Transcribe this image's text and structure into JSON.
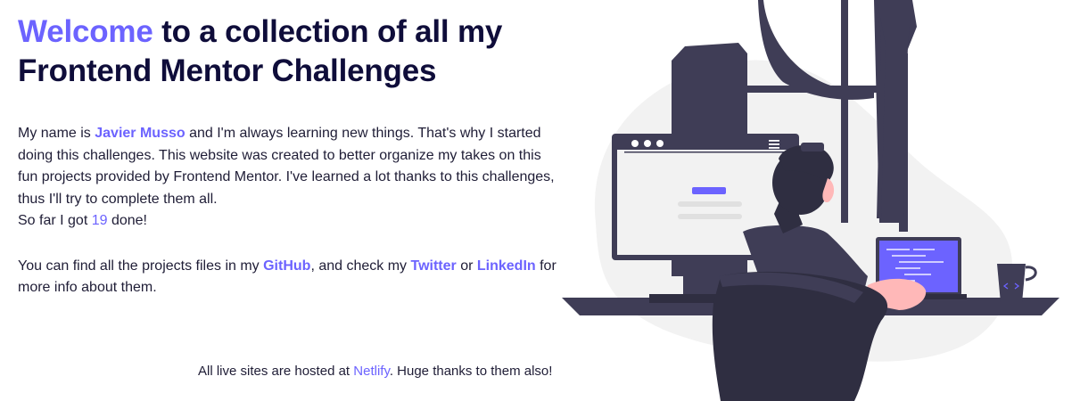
{
  "heading": {
    "accent_word": "Welcome",
    "rest_line1": " to a collection of all my",
    "line2": "Frontend Mentor Challenges"
  },
  "intro": {
    "prefix": "My name is ",
    "name_link": "Javier Musso",
    "middle": " and I'm always learning new things. That's why I started doing this challenges. This website was created to better organize my takes on this fun projects provided by Frontend Mentor. I've learned a lot thanks to this challenges, thus I'll try to complete them all.",
    "count_prefix": "So far I got ",
    "count": "19",
    "count_suffix": " done!"
  },
  "links_paragraph": {
    "prefix": "You can find all the projects files in my ",
    "github_link": "GitHub",
    "middle": ", and check my ",
    "twitter_link": "Twitter",
    "or": " or ",
    "linkedin_link": "LinkedIn",
    "suffix": " for more info about them."
  },
  "footer": {
    "prefix": "All live sites are hosted at ",
    "netlify_link": "Netlify",
    "suffix": ". Huge thanks to them also!"
  },
  "colors": {
    "accent": "#6c63ff",
    "heading": "#0f0d3a",
    "dark": "#3f3d56"
  },
  "illustration": {
    "icon": "developer-at-desk-illustration"
  }
}
